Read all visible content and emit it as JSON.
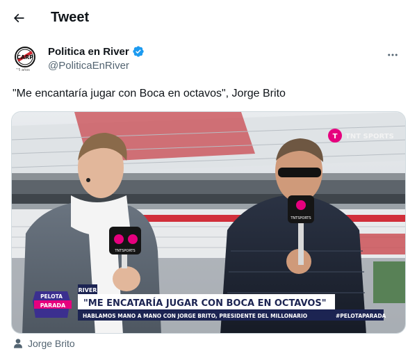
{
  "header": {
    "title": "Tweet"
  },
  "author": {
    "display_name": "Politica en River",
    "handle": "@PoliticaEnRiver",
    "verified": true,
    "avatar_text": "CARP",
    "avatar_sub": "15 años"
  },
  "tweet": {
    "text": "\"Me encantaría jugar con Boca en octavos\", Jorge Brito"
  },
  "media": {
    "broadcaster": "TNT SPORTS",
    "show_logo_top": "PELOTA",
    "show_logo_bottom": "PARADA",
    "tag": "RIVER",
    "headline": "\"ME ENCATARÍA JUGAR CON BOCA EN OCTAVOS\"",
    "subline": "HABLAMOS MANO A MANO CON JORGE BRITO, PRESIDENTE DEL MILLONARIO",
    "hashtag": "#PELOTAPARADA",
    "mic_label": "TNTSPORTS"
  },
  "caption": {
    "tagged_person": "Jorge Brito"
  },
  "colors": {
    "verified_blue": "#1d9bf0",
    "secondary_text": "#536471",
    "banner_navy": "#1c2452",
    "banner_magenta": "#e6007e"
  }
}
